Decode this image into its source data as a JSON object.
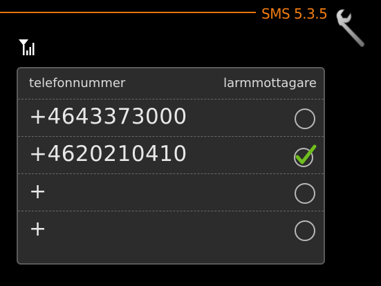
{
  "header": {
    "menu_code": "SMS 5.3.5",
    "settings_icon": "wrench-icon",
    "signal_icon": "signal-strength-icon"
  },
  "table": {
    "col_phone": "telefonnummer",
    "col_alarm": "larmmottagare",
    "rows": [
      {
        "number": "+4643373000",
        "alarm_receiver": false
      },
      {
        "number": "+4620210410",
        "alarm_receiver": true
      },
      {
        "number": "+",
        "alarm_receiver": false
      },
      {
        "number": "+",
        "alarm_receiver": false
      }
    ]
  },
  "colors": {
    "accent": "#f07c10",
    "check_green": "#6fbe1e",
    "panel_bg": "#2c2c2c"
  }
}
